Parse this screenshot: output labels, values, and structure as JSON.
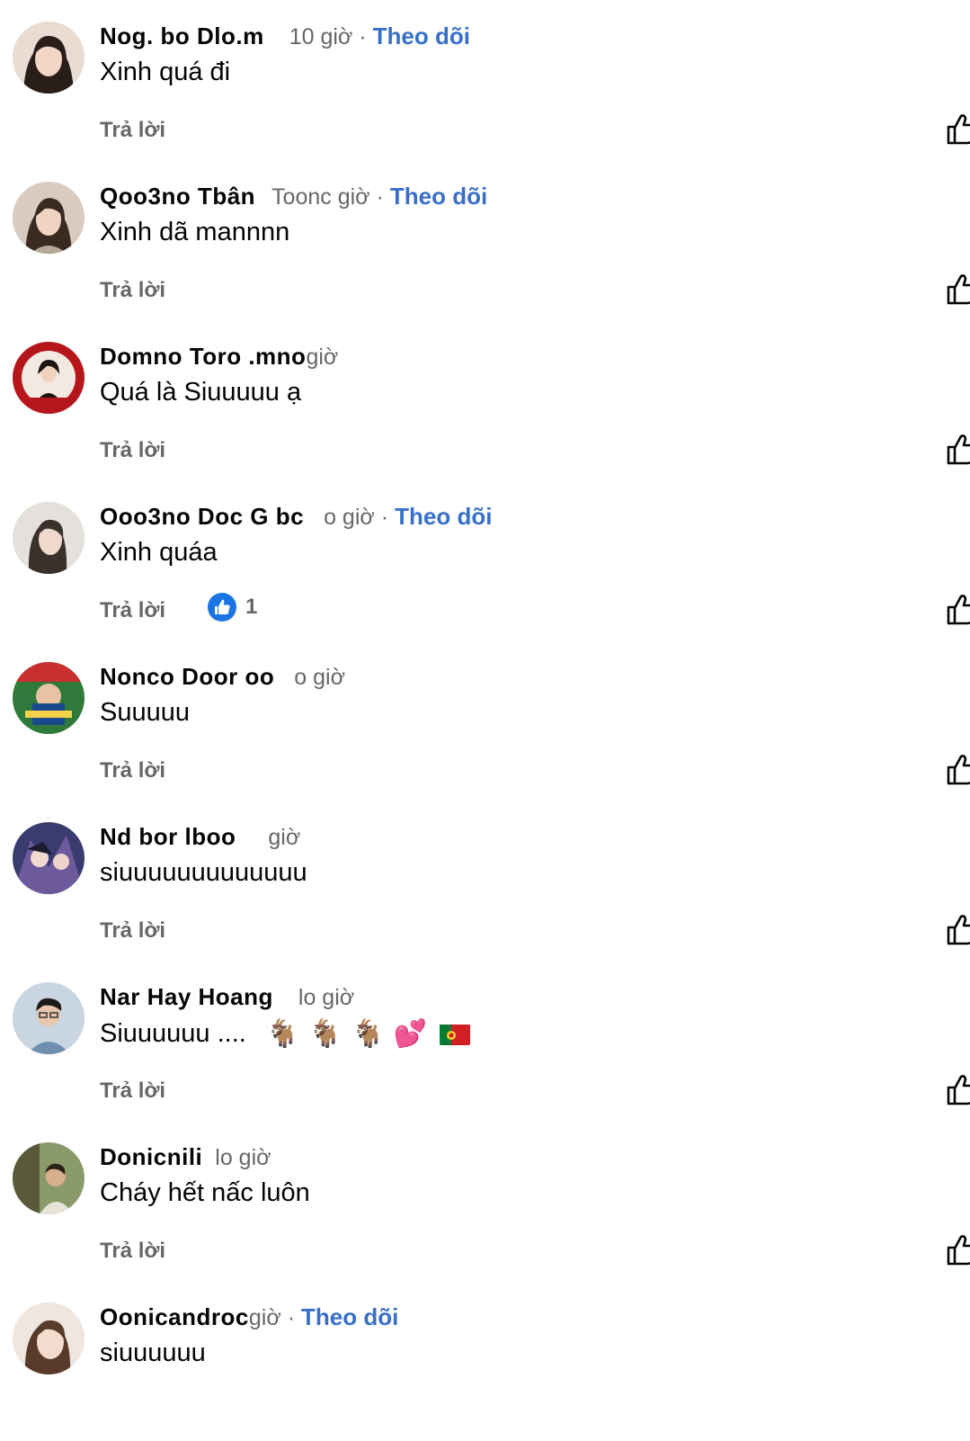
{
  "reply_label": "Trả lời",
  "follow_label": "Theo dõi",
  "comments": [
    {
      "author": "Nog. bo Dlo.m",
      "time": "10 giờ",
      "text": "Xinh quá đi",
      "follow": true
    },
    {
      "author": "Qoo3no Tbân",
      "time": "Toonc giờ",
      "text": "Xinh dã mannnn",
      "follow": true
    },
    {
      "author": "Domno Toro .mno",
      "time": "giờ",
      "text": "Quá là Siuuuuu ạ",
      "follow": false
    },
    {
      "author": "Ooo3no Doc G bc",
      "time": "o giờ",
      "text": "Xinh quáa",
      "follow": true,
      "reaction_count": "1"
    },
    {
      "author": "Nonco Door oo",
      "time": "o giờ",
      "text": "Suuuuu",
      "follow": false
    },
    {
      "author": "Nd bor lboo",
      "time": "giờ",
      "text": "siuuuuuuuuuuuuu",
      "follow": false
    },
    {
      "author": "Nar Hay Hoang",
      "time": "lo giờ",
      "text": "Siuuuuuu ....",
      "follow": false,
      "emojis": [
        "🐐",
        "🐐",
        "🐐",
        "💕"
      ],
      "flag": "portugal-flag"
    },
    {
      "author": "Donicnili",
      "time": "lo giờ",
      "text": "Cháy hết nấc luôn",
      "follow": false
    },
    {
      "author": "Oonicandroc",
      "time": "giờ",
      "text": "siuuuuuu",
      "follow": true
    }
  ],
  "colors": {
    "follow": "#3870c9",
    "muted": "#65676b",
    "reaction": "#1b74e4"
  }
}
